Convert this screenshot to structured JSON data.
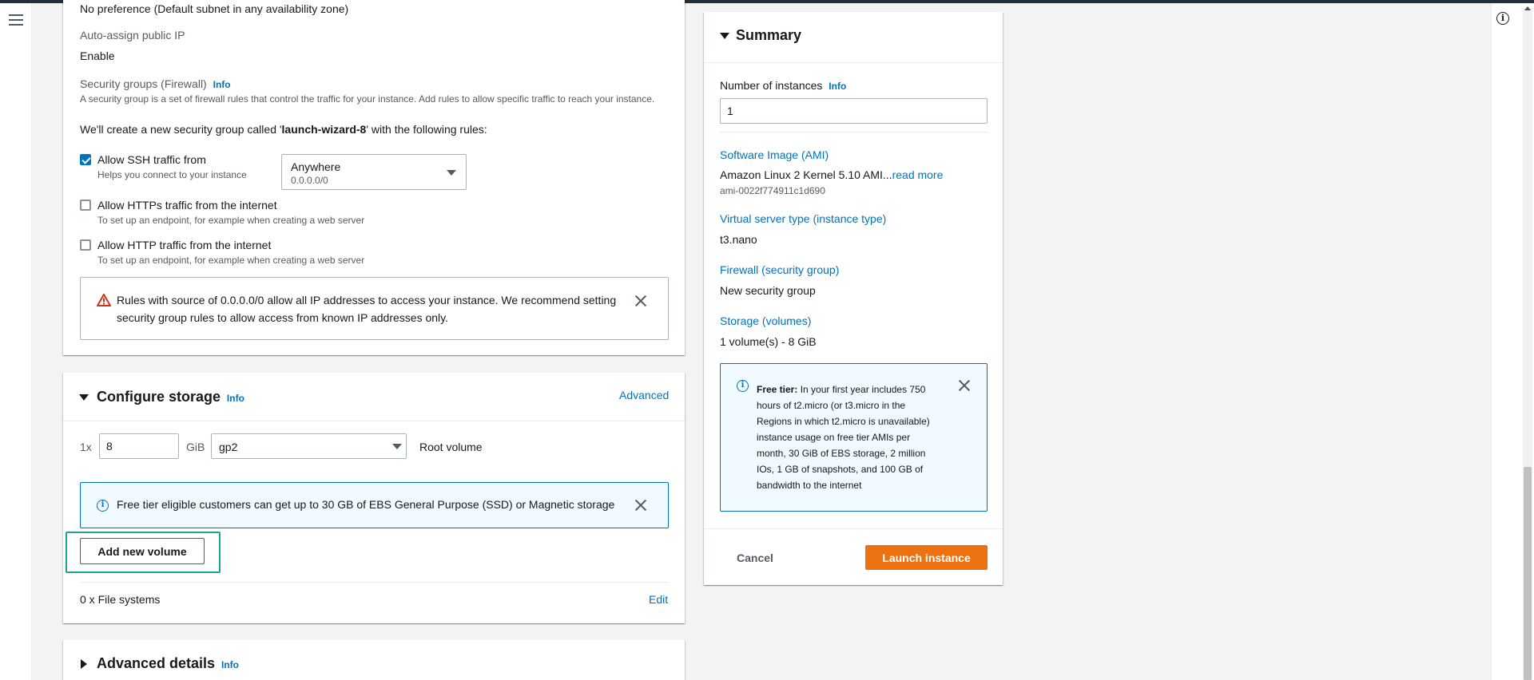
{
  "network": {
    "subnet_value": "No preference (Default subnet in any availability zone)",
    "auto_assign_label": "Auto-assign public IP",
    "auto_assign_value": "Enable",
    "sg_label": "Security groups (Firewall)",
    "info": "Info",
    "sg_description": "A security group is a set of firewall rules that control the traffic for your instance. Add rules to allow specific traffic to reach your instance.",
    "sg_create_prefix": "We'll create a new security group called '",
    "sg_name": "launch-wizard-8",
    "sg_create_suffix": "' with the following rules:",
    "rules": [
      {
        "label": "Allow SSH traffic from",
        "desc": "Helps you connect to your instance",
        "checked": true
      },
      {
        "label": "Allow HTTPs traffic from the internet",
        "desc": "To set up an endpoint, for example when creating a web server",
        "checked": false
      },
      {
        "label": "Allow HTTP traffic from the internet",
        "desc": "To set up an endpoint, for example when creating a web server",
        "checked": false
      }
    ],
    "ssh_source": {
      "selected": "Anywhere",
      "sub": "0.0.0.0/0"
    },
    "warning_text": "Rules with source of 0.0.0.0/0 allow all IP addresses to access your instance. We recommend setting security group rules to allow access from known IP addresses only."
  },
  "storage": {
    "title": "Configure storage",
    "info": "Info",
    "advanced": "Advanced",
    "count_prefix": "1x",
    "size": "8",
    "unit": "GiB",
    "volume_type": "gp2",
    "root_label": "Root volume",
    "free_tier_text": "Free tier eligible customers can get up to 30 GB of EBS General Purpose (SSD) or Magnetic storage",
    "add_volume_label": "Add new volume",
    "fs_label": "0 x File systems",
    "edit": "Edit"
  },
  "advanced_details": {
    "title": "Advanced details",
    "info": "Info"
  },
  "summary": {
    "title": "Summary",
    "instances_label": "Number of instances",
    "info": "Info",
    "instances_value": "1",
    "ami_label": "Software Image (AMI)",
    "ami_value": "Amazon Linux 2 Kernel 5.10 AMI...",
    "ami_read_more": "read more",
    "ami_id": "ami-0022f774911c1d690",
    "type_label": "Virtual server type (instance type)",
    "type_value": "t3.nano",
    "firewall_label": "Firewall (security group)",
    "firewall_value": "New security group",
    "storage_label": "Storage (volumes)",
    "storage_value": "1 volume(s) - 8 GiB",
    "free_tier_heading": "Free tier:",
    "free_tier_lines": [
      "In your first year includes 750",
      "hours of t2.micro (or t3.micro in the",
      "Regions in which t2.micro is unavailable)",
      "instance usage on free tier AMIs per",
      "month, 30 GiB of EBS storage, 2 million",
      "IOs, 1 GB of snapshots, and 100 GB of",
      "bandwidth to the internet"
    ],
    "cancel": "Cancel",
    "launch": "Launch instance"
  },
  "colors": {
    "link": "#0073bb",
    "primary": "#ec7211",
    "warning": "#d13212",
    "focus_ring": "#1aa68f"
  }
}
